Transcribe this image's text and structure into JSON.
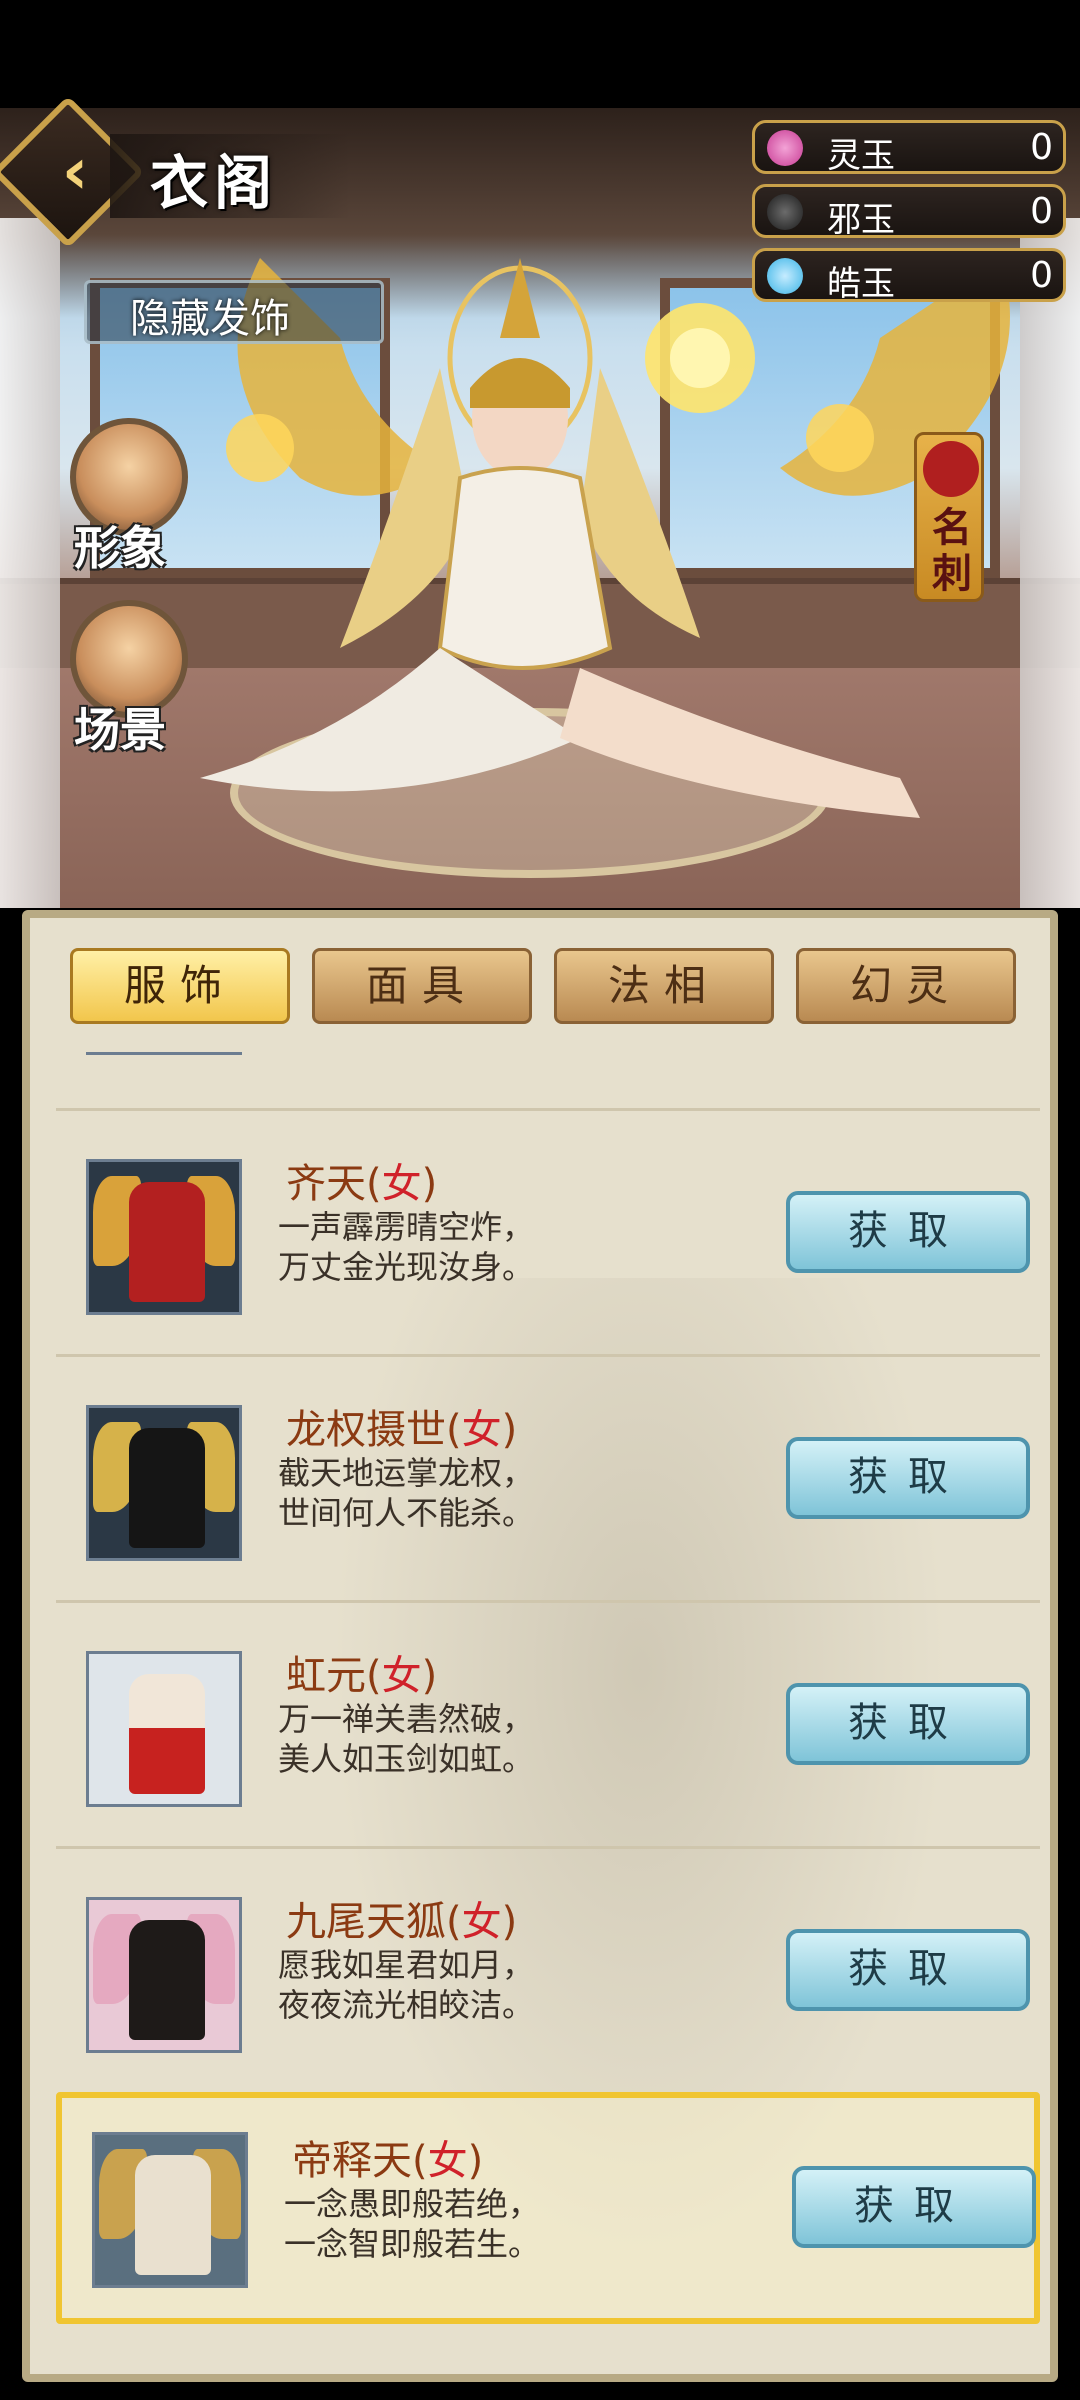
{
  "header": {
    "title": "衣阁",
    "subtitle": "隐藏发饰"
  },
  "currencies": [
    {
      "name": "灵玉",
      "value": "0",
      "icon": "spirit-jade-icon",
      "color": "#c73a93"
    },
    {
      "name": "邪玉",
      "value": "0",
      "icon": "evil-jade-icon",
      "color": "#1b1b1b"
    },
    {
      "name": "皓玉",
      "value": "0",
      "icon": "bright-jade-icon",
      "color": "#3ab4e6"
    }
  ],
  "side_buttons": [
    {
      "label": "形象",
      "icon": "avatar-icon"
    },
    {
      "label": "场景",
      "icon": "scene-icon"
    }
  ],
  "name_tag": {
    "label": "名刺"
  },
  "tabs": [
    {
      "label": "服饰",
      "active": true
    },
    {
      "label": "面具",
      "active": false
    },
    {
      "label": "法相",
      "active": false
    },
    {
      "label": "幻灵",
      "active": false
    }
  ],
  "items": [
    {
      "name": "齐天",
      "sex": "女",
      "desc": "一声霹雳晴空炸，\n万丈金光现汝身。",
      "button": "获取",
      "colors": [
        "#b32020",
        "#d9a23a"
      ]
    },
    {
      "name": "龙权摄世",
      "sex": "女",
      "desc": "截天地运掌龙权，\n世间何人不能杀。",
      "button": "获取",
      "colors": [
        "#151515",
        "#d6b24a"
      ]
    },
    {
      "name": "虹元",
      "sex": "女",
      "desc": "万一禅关砉然破，\n美人如玉剑如虹。",
      "button": "获取",
      "colors": [
        "#c7221f",
        "#f1e6d8"
      ]
    },
    {
      "name": "九尾天狐",
      "sex": "女",
      "desc": "愿我如星君如月，\n夜夜流光相皎洁。",
      "button": "获取",
      "colors": [
        "#1e1a18",
        "#e5a9c0"
      ]
    },
    {
      "name": "帝释天",
      "sex": "女",
      "desc": "一念愚即般若绝，\n一念智即般若生。",
      "button": "获取",
      "colors": [
        "#e9e0cf",
        "#c9a24e"
      ],
      "selected": true
    }
  ]
}
